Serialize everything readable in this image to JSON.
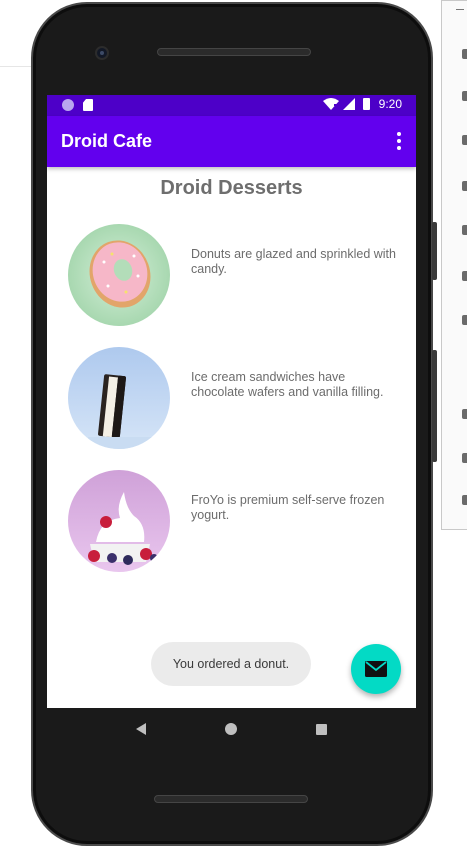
{
  "status_bar": {
    "time": "9:20"
  },
  "app_bar": {
    "title": "Droid Cafe"
  },
  "page": {
    "heading": "Droid Desserts"
  },
  "desserts": [
    {
      "description": "Donuts are glazed and sprinkled with candy."
    },
    {
      "description": "Ice cream sandwiches have chocolate wafers and vanilla filling."
    },
    {
      "description": "FroYo is premium self-serve frozen yogurt."
    }
  ],
  "toast": {
    "message": "You ordered a donut."
  },
  "icons": {
    "fab": "mail-icon",
    "overflow": "more-vert-icon",
    "nav": [
      "back-icon",
      "home-icon",
      "recents-icon"
    ]
  },
  "colors": {
    "status_bar": "#4d00c8",
    "app_bar": "#6200ee",
    "fab": "#03dac5",
    "heading_text": "#6e6e6e"
  }
}
